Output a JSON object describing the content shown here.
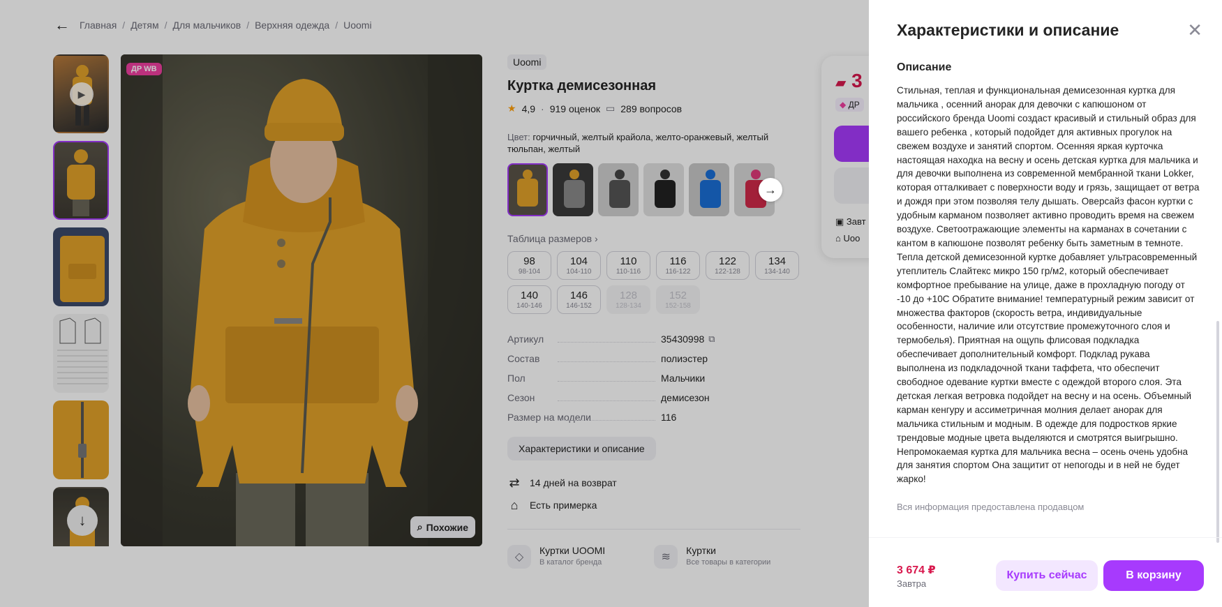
{
  "breadcrumb": [
    "Главная",
    "Детям",
    "Для мальчиков",
    "Верхняя одежда",
    "Uoomi"
  ],
  "gallery": {
    "badge": "ДР WB",
    "similar_label": "Похожие"
  },
  "product": {
    "brand": "Uoomi",
    "title": "Куртка демисезонная",
    "rating": "4,9",
    "reviews": "919 оценок",
    "questions": "289 вопросов",
    "color_label": "Цвет:",
    "color_value": "горчичный, желтый крайола, желто-оранжевый, желтый тюльпан, желтый",
    "size_table_label": "Таблица размеров",
    "sizes": [
      {
        "size": "98",
        "range": "98-104",
        "disabled": false
      },
      {
        "size": "104",
        "range": "104-110",
        "disabled": false
      },
      {
        "size": "110",
        "range": "110-116",
        "disabled": false
      },
      {
        "size": "116",
        "range": "116-122",
        "disabled": false
      },
      {
        "size": "122",
        "range": "122-128",
        "disabled": false
      },
      {
        "size": "134",
        "range": "134-140",
        "disabled": false
      },
      {
        "size": "140",
        "range": "140-146",
        "disabled": false
      },
      {
        "size": "146",
        "range": "146-152",
        "disabled": false
      },
      {
        "size": "128",
        "range": "128-134",
        "disabled": true
      },
      {
        "size": "152",
        "range": "152-158",
        "disabled": true
      }
    ],
    "specs": [
      {
        "key": "Артикул",
        "value": "35430998"
      },
      {
        "key": "Состав",
        "value": "полиэстер"
      },
      {
        "key": "Пол",
        "value": "Мальчики"
      },
      {
        "key": "Сезон",
        "value": "демисезон"
      },
      {
        "key": "Размер на модели",
        "value": "116"
      }
    ],
    "char_button": "Характеристики и описание",
    "features": [
      "14 дней на возврат",
      "Есть примерка"
    ],
    "links": [
      {
        "title": "Куртки UOOMI",
        "sub": "В каталог бренда"
      },
      {
        "title": "Куртки",
        "sub": "Все товары в категории"
      }
    ]
  },
  "buybox": {
    "price_partial": "3",
    "dr_partial": "ДР",
    "line1": "Завт",
    "line2": "Uoo"
  },
  "panel": {
    "title": "Характеристики и описание",
    "desc_heading": "Описание",
    "desc_text": "Стильная, теплая и функциональная демисезонная куртка для мальчика , осенний анорак для девочки с капюшоном от российского бренда Uoomi создаст красивый и стильный образ для вашего ребенка , который подойдет для активных прогулок на свежем воздухе и занятий спортом. Осенняя яркая курточка настоящая находка на весну и осень детская куртка для мальчика и для девочки выполнена из современной мембранной ткани Lokker, которая отталкивает с поверхности воду и грязь, защищает от ветра и дождя при этом позволяя телу дышать. Оверсайз фасон куртки с удобным карманом позволяет активно проводить время на свежем воздухе. Светоотражающие элементы на карманах в сочетании с кантом в капюшоне позволят ребенку быть заметным в темноте. Тепла детской демисезонной куртке добавляет ультрасовременный утеплитель Слайтекс микро 150 гр/м2, который обеспечивает комфортное пребывание на улице, даже в прохладную погоду от -10 до +10С Обратите внимание! температурный режим зависит от множества факторов (скорость ветра, индивидуальные особенности, наличие или отсутствие промежуточного слоя и термобелья). Приятная на ощупь флисовая подкладка обеспечивает дополнительный комфорт. Подклад рукава выполнена из подкладочной ткани таффета, что обеспечит свободное одевание куртки вместе с одеждой второго слоя. Эта детская легкая ветровка подойдет на весну и на осень. Объемный карман кенгуру и ассиметричная молния делает анорак для мальчика стильным и модным. В одежде для подростков яркие трендовые модные цвета выделяются и смотрятся выигрышно. Непромокаемая куртка для мальчика весна – осень очень удобна для занятия спортом Она защитит от непогоды и в ней не будет жарко!",
    "note": "Вся информация предоставлена продавцом",
    "price": "3 674 ₽",
    "delivery": "Завтра",
    "buy_now": "Купить сейчас",
    "to_cart": "В корзину"
  },
  "colors": {
    "accent": "#a73afd",
    "price": "#d8184d",
    "badge": "#f03fa0",
    "jacket": "#e2a22a"
  }
}
